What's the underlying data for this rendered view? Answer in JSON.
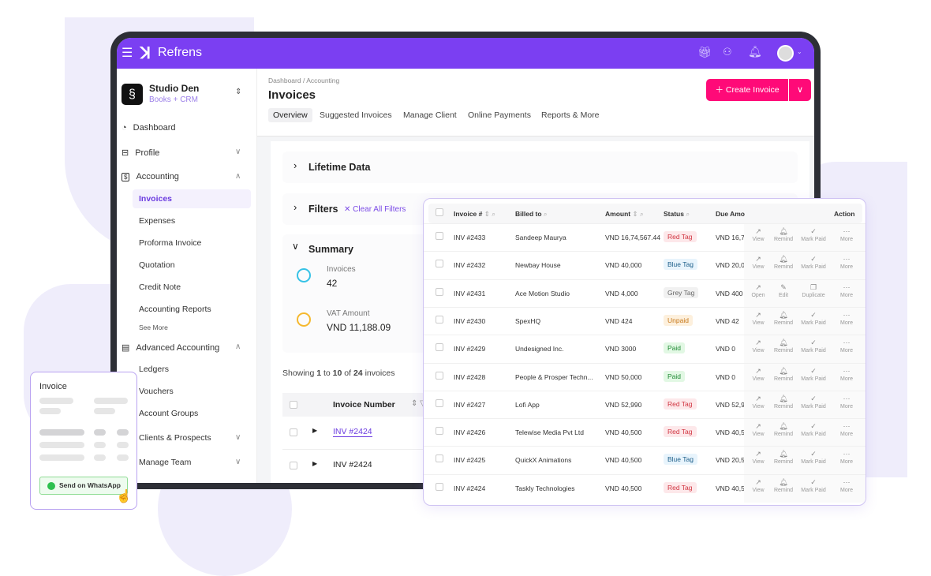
{
  "brand": {
    "name": "Refrens",
    "accent": "#7b3ff2",
    "cta_color": "#ff0a78"
  },
  "topbar": {
    "icons": [
      "menu-icon",
      "gift-icon",
      "team-icon",
      "bell-icon",
      "avatar"
    ]
  },
  "workspace": {
    "name": "Studio Den",
    "subtitle": "Books + CRM"
  },
  "sidebar": {
    "items": [
      {
        "label": "Dashboard",
        "icon": "dashboard-icon"
      },
      {
        "label": "Profile",
        "icon": "profile-icon"
      },
      {
        "label": "Accounting",
        "icon": "dollar-icon"
      },
      {
        "label": "Advanced Accounting",
        "icon": "document-icon"
      },
      {
        "label": "Clients & Prospects"
      },
      {
        "label": "Manage Team"
      }
    ],
    "accounting_sub": [
      "Invoices",
      "Expenses",
      "Proforma Invoice",
      "Quotation",
      "Credit Note",
      "Accounting Reports"
    ],
    "see_more": "See More",
    "advanced_sub": [
      "Ledgers",
      "Vouchers",
      "Account Groups"
    ]
  },
  "main": {
    "breadcrumb": "Dashboard / Accounting",
    "title": "Invoices",
    "create_label": "Create Invoice",
    "tabs": [
      "Overview",
      "Suggested Invoices",
      "Manage Client",
      "Online Payments",
      "Reports & More"
    ],
    "lifetime": "Lifetime Data",
    "filters": "Filters",
    "clear_filters": "Clear All Filters",
    "summary": "Summary",
    "invoices_label": "Invoices",
    "invoices_count": "42",
    "vat_label": "VAT Amount",
    "vat_value": "VND 11,188.09",
    "showing": {
      "pre": "Showing",
      "from": "1",
      "to_word": "to",
      "to": "10",
      "of_word": "of",
      "total": "24",
      "post": "invoices"
    },
    "col_invoice_number": "Invoice Number",
    "rows": [
      "INV #2424",
      "INV #2424"
    ]
  },
  "table": {
    "headers": [
      "Invoice #",
      "Billed to",
      "Amount",
      "Status",
      "Due Amo",
      "Action"
    ],
    "rows": [
      {
        "inv": "INV #2433",
        "billed": "Sandeep  Maurya",
        "amount": "VND 16,74,567.44",
        "status": "Red Tag",
        "due": "VND 16,7",
        "actions": [
          "View",
          "Remind",
          "Mark Paid",
          "More"
        ]
      },
      {
        "inv": "INV #2432",
        "billed": "Newbay House",
        "amount": "VND 40,000",
        "status": "Blue Tag",
        "due": "VND 20,0",
        "actions": [
          "View",
          "Remind",
          "Mark Paid",
          "More"
        ]
      },
      {
        "inv": "INV #2431",
        "billed": "Ace Motion Studio",
        "amount": "VND 4,000",
        "status": "Grey Tag",
        "due": "VND 400",
        "actions": [
          "Open",
          "Edit",
          "Duplicate",
          "More"
        ]
      },
      {
        "inv": "INV #2430",
        "billed": "SpexHQ",
        "amount": "VND  424",
        "status": "Unpaid",
        "due": "VND  42",
        "actions": [
          "View",
          "Remind",
          "Mark Paid",
          "More"
        ]
      },
      {
        "inv": "INV #2429",
        "billed": "Undesigned Inc.",
        "amount": "VND  3000",
        "status": "Paid",
        "due": "VND  0",
        "actions": [
          "View",
          "Remind",
          "Mark Paid",
          "More"
        ]
      },
      {
        "inv": "INV #2428",
        "billed": "People & Prosper Techn...",
        "amount": "VND 50,000",
        "status": "Paid",
        "due": "VND 0",
        "actions": [
          "View",
          "Remind",
          "Mark Paid",
          "More"
        ]
      },
      {
        "inv": "INV #2427",
        "billed": "Lofi App",
        "amount": "VND 52,990",
        "status": "Red Tag",
        "due": "VND 52,9",
        "actions": [
          "View",
          "Remind",
          "Mark Paid",
          "More"
        ]
      },
      {
        "inv": "INV #2426",
        "billed": "Telewise Media Pvt Ltd",
        "amount": "VND 40,500",
        "status": "Red Tag",
        "due": "VND 40,5",
        "actions": [
          "View",
          "Remind",
          "Mark Paid",
          "More"
        ]
      },
      {
        "inv": "INV #2425",
        "billed": "QuickX Animations",
        "amount": "VND 40,500",
        "status": "Blue Tag",
        "due": "VND 20,5",
        "actions": [
          "View",
          "Remind",
          "Mark Paid",
          "More"
        ]
      },
      {
        "inv": "INV #2424",
        "billed": "Taskly Technologies",
        "amount": "VND 40,500",
        "status": "Red Tag",
        "due": "VND 40,5",
        "actions": [
          "View",
          "Remind",
          "Mark Paid",
          "More"
        ]
      }
    ]
  },
  "whatsapp_card": {
    "title": "Invoice",
    "button": "Send on WhatsApp"
  }
}
